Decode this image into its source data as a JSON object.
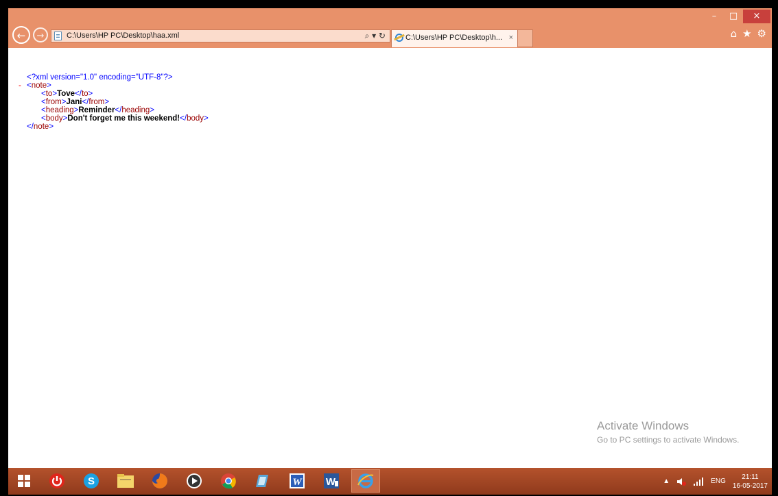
{
  "browser": {
    "address": "C:\\Users\\HP PC\\Desktop\\haa.xml",
    "address_tools": "⌕ ▾ ↻",
    "tab_title": "C:\\Users\\HP PC\\Desktop\\h...",
    "tab_close": "×",
    "window_controls": {
      "minimize": "–",
      "restore": "□",
      "close": "×"
    },
    "tools": {
      "home": "⌂",
      "favorites": "★",
      "settings": "⚙"
    }
  },
  "xml": {
    "declaration": "<?xml version=\"1.0\" encoding=\"UTF-8\"?>",
    "collapse": "-",
    "root_open": "note",
    "children": [
      {
        "tag": "to",
        "value": "Tove"
      },
      {
        "tag": "from",
        "value": "Jani"
      },
      {
        "tag": "heading",
        "value": "Reminder"
      },
      {
        "tag": "body",
        "value": "Don't forget me this weekend!"
      }
    ],
    "root_close": "note",
    "lt": "<",
    "gt": ">",
    "close_lt": "</"
  },
  "watermark": {
    "title": "Activate Windows",
    "subtitle": "Go to PC settings to activate Windows."
  },
  "taskbar": {
    "apps": [
      "windows-start",
      "power",
      "skype",
      "file-explorer",
      "firefox",
      "media-player",
      "chrome",
      "app",
      "word-2003",
      "word",
      "internet-explorer"
    ],
    "tray": {
      "expand": "▲",
      "lang": "ENG",
      "time": "21:11",
      "date": "16-05-2017"
    }
  }
}
